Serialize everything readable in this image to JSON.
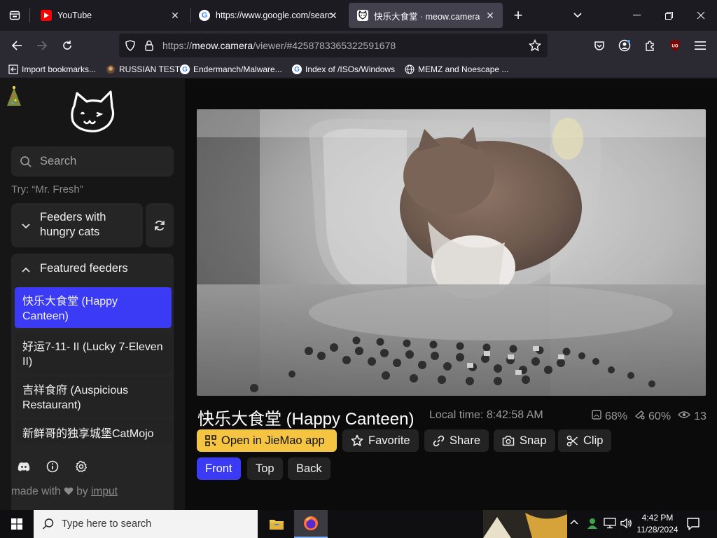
{
  "browser": {
    "tabs": [
      {
        "title": "YouTube",
        "icon": "youtube-icon",
        "active": false
      },
      {
        "title": "https://www.google.com/searc",
        "icon": "google-icon",
        "active": false
      },
      {
        "title": "快乐大食堂 · meow.camera",
        "icon": "meow-cat-icon",
        "active": true
      }
    ],
    "url": {
      "scheme": "https://",
      "host": "meow.camera",
      "rest": "/viewer/#4258783365322591678"
    },
    "bookmarks": [
      {
        "label": "Import bookmarks...",
        "icon": "import-icon"
      },
      {
        "label": "RUSSIAN TEST",
        "icon": "globe-icon"
      },
      {
        "label": "Endermanch/Malware...",
        "icon": "google-icon"
      },
      {
        "label": "Index of /ISOs/Windows",
        "icon": "google-icon"
      },
      {
        "label": "MEMZ and Noescape ...",
        "icon": "globe-icon"
      }
    ]
  },
  "sidebar": {
    "search_placeholder": "Search",
    "hint": "Try: “Mr. Fresh”",
    "filter_label": "Feeders with hungry cats",
    "featured_label": "Featured feeders",
    "feeders": [
      {
        "name": "快乐大食堂 (Happy Canteen)",
        "selected": true
      },
      {
        "name": "好运7-11- II (Lucky 7-Eleven II)",
        "selected": false
      },
      {
        "name": "吉祥食府 (Auspicious Restaurant)",
        "selected": false
      },
      {
        "name": "新鲜哥的独享城堡CatMojo",
        "selected": false
      }
    ],
    "footer_made": "made with",
    "footer_by": "by",
    "footer_link": "imput"
  },
  "viewer": {
    "title": "快乐大食堂 (Happy Canteen)",
    "local_time_label": "Local time: 8:42:58 AM",
    "stat_food": "68%",
    "stat_fill": "60%",
    "stat_viewers": "13",
    "buttons": {
      "open_app": "Open in JieMao app",
      "favorite": "Favorite",
      "share": "Share",
      "snap": "Snap",
      "clip": "Clip"
    },
    "cameras": [
      "Front",
      "Top",
      "Back"
    ],
    "active_camera": "Front"
  },
  "colors": {
    "accent_blue": "#3b3bf5",
    "accent_yellow": "#f5c542"
  },
  "taskbar": {
    "search_placeholder": "Type here to search",
    "time": "4:42 PM",
    "date": "11/28/2024"
  }
}
